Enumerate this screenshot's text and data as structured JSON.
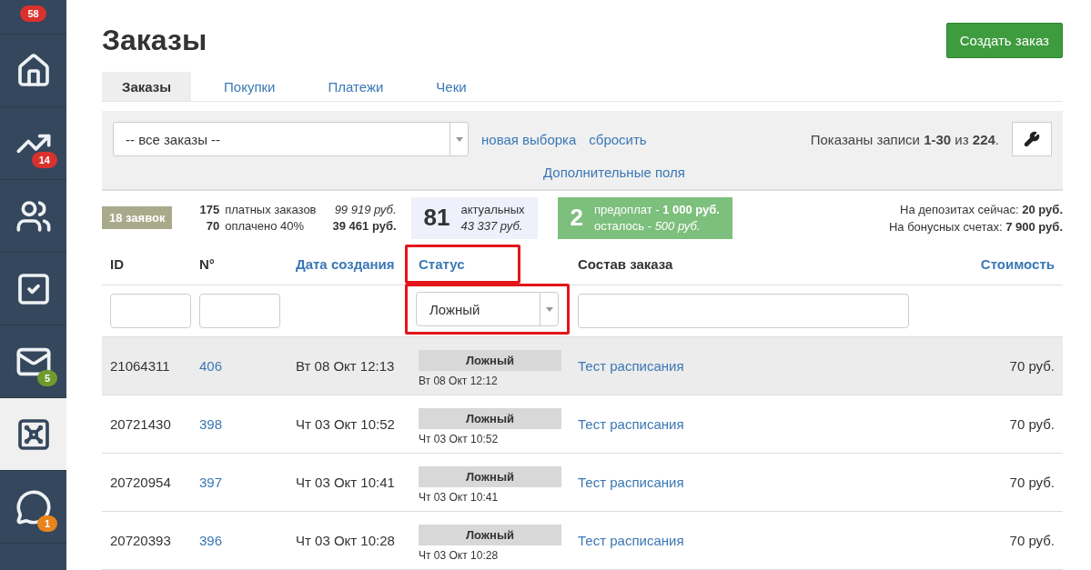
{
  "sidebar": {
    "top_badge": {
      "text": "58",
      "color": "#d9312d"
    },
    "items": [
      {
        "kind": "home",
        "selected": false
      },
      {
        "kind": "chart",
        "badge": {
          "text": "14",
          "color": "#d9312d"
        },
        "selected": false
      },
      {
        "kind": "users",
        "selected": false
      },
      {
        "kind": "check",
        "selected": false
      },
      {
        "kind": "mail",
        "badge": {
          "text": "5",
          "color": "#6f9a2e"
        },
        "selected": false
      },
      {
        "kind": "safe",
        "selected": true
      },
      {
        "kind": "chat",
        "badge": {
          "text": "1",
          "color": "#e8841c"
        },
        "selected": false
      }
    ]
  },
  "header": {
    "title": "Заказы",
    "create_button": "Создать заказ"
  },
  "tabs": [
    {
      "label": "Заказы",
      "selected": true
    },
    {
      "label": "Покупки",
      "selected": false
    },
    {
      "label": "Платежи",
      "selected": false
    },
    {
      "label": "Чеки",
      "selected": false
    }
  ],
  "filter_bar": {
    "select_value": "-- все заказы --",
    "links": [
      "новая выборка",
      "сбросить"
    ],
    "extra_fields_link": "Дополнительные поля",
    "records_info": "Показаны записи **1-30** из **224**."
  },
  "stats": {
    "requests_badge": "18 заявок",
    "summary": [
      {
        "count": "175",
        "label": "платных заказов",
        "amount": "99 919 руб.",
        "kind": "pending"
      },
      {
        "count": "70",
        "label": "оплачено 40%",
        "amount": "39 461 руб.",
        "kind": "paid"
      }
    ],
    "actual": {
      "count": "81",
      "label": "актуальных",
      "amount": "43 337 руб."
    },
    "prepaid": {
      "count": "2",
      "line_1": "предоплат - **1 000 руб.**",
      "line_2": "осталось - *500 руб.*"
    },
    "balances": [
      "На депозитах сейчас: **20 руб.**",
      "На бонусных счетах: **7 900 руб.**"
    ]
  },
  "table": {
    "columns": [
      {
        "label": "ID",
        "kind": "plain",
        "highlighted": false,
        "filter": {
          "kind": "input"
        }
      },
      {
        "label": "N°",
        "kind": "plain",
        "highlighted": false,
        "filter": {
          "kind": "input"
        }
      },
      {
        "label": "Дата создания",
        "kind": "link",
        "highlighted": false
      },
      {
        "label": "Статус",
        "kind": "link",
        "highlighted": true,
        "filter": {
          "kind": "select",
          "value": "Ложный"
        }
      },
      {
        "label": "Состав заказа",
        "kind": "plain",
        "highlighted": false,
        "filter": {
          "kind": "wide"
        }
      },
      {
        "label": "Стоимость",
        "kind": "link",
        "highlighted": false
      }
    ],
    "rows": [
      {
        "id": "21064311",
        "number": "406",
        "date": "Вт 08 Окт 12:13",
        "status": "Ложный",
        "status_date": "Вт 08 Окт 12:12",
        "composition": "Тест расписания",
        "cost": "70 руб.",
        "hovered": true
      },
      {
        "id": "20721430",
        "number": "398",
        "date": "Чт 03 Окт 10:52",
        "status": "Ложный",
        "status_date": "Чт 03 Окт 10:52",
        "composition": "Тест расписания",
        "cost": "70 руб.",
        "hovered": false
      },
      {
        "id": "20720954",
        "number": "397",
        "date": "Чт 03 Окт 10:41",
        "status": "Ложный",
        "status_date": "Чт 03 Окт 10:41",
        "composition": "Тест расписания",
        "cost": "70 руб.",
        "hovered": false
      },
      {
        "id": "20720393",
        "number": "396",
        "date": "Чт 03 Окт 10:28",
        "status": "Ложный",
        "status_date": "Чт 03 Окт 10:28",
        "composition": "Тест расписания",
        "cost": "70 руб.",
        "hovered": false
      }
    ]
  }
}
